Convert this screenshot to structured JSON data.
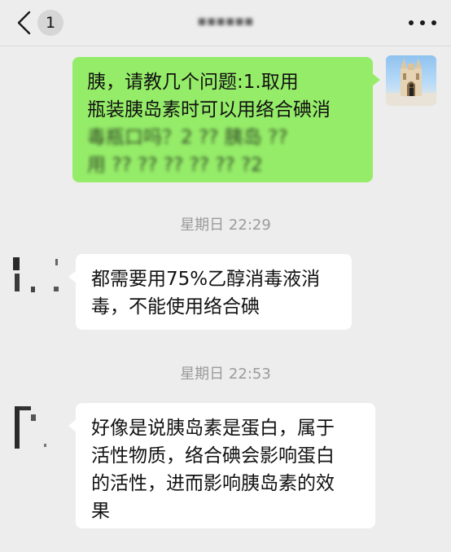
{
  "header": {
    "unread_count": "1",
    "title": "▪▪▪▪▪▪",
    "back_icon": "chevron-left-icon",
    "more_icon": "more-dots-icon"
  },
  "messages": [
    {
      "sender": "self",
      "lines": [
        "    胰，请教几个问题:1.取用",
        "瓶装胰岛素时可以用络合碘消",
        "毒瓶口吗？2 ?? 胰岛 ??",
        "用 ?? ?? ?? ?? ?? ?2"
      ]
    },
    {
      "sender": "other",
      "time": "星期日 22:29",
      "lines": [
        "都需要用75%乙醇消毒液消",
        "毒，不能使用络合碘"
      ]
    },
    {
      "sender": "other",
      "time": "星期日 22:53",
      "lines": [
        "好像是说胰岛素是蛋白，属于",
        "活性物质，络合碘会影响蛋白",
        "的活性，进而影响胰岛素的效",
        "果"
      ]
    }
  ],
  "colors": {
    "background": "#ededed",
    "self_bubble": "#95ec69",
    "other_bubble": "#ffffff",
    "timestamp": "#9b9b9b"
  }
}
